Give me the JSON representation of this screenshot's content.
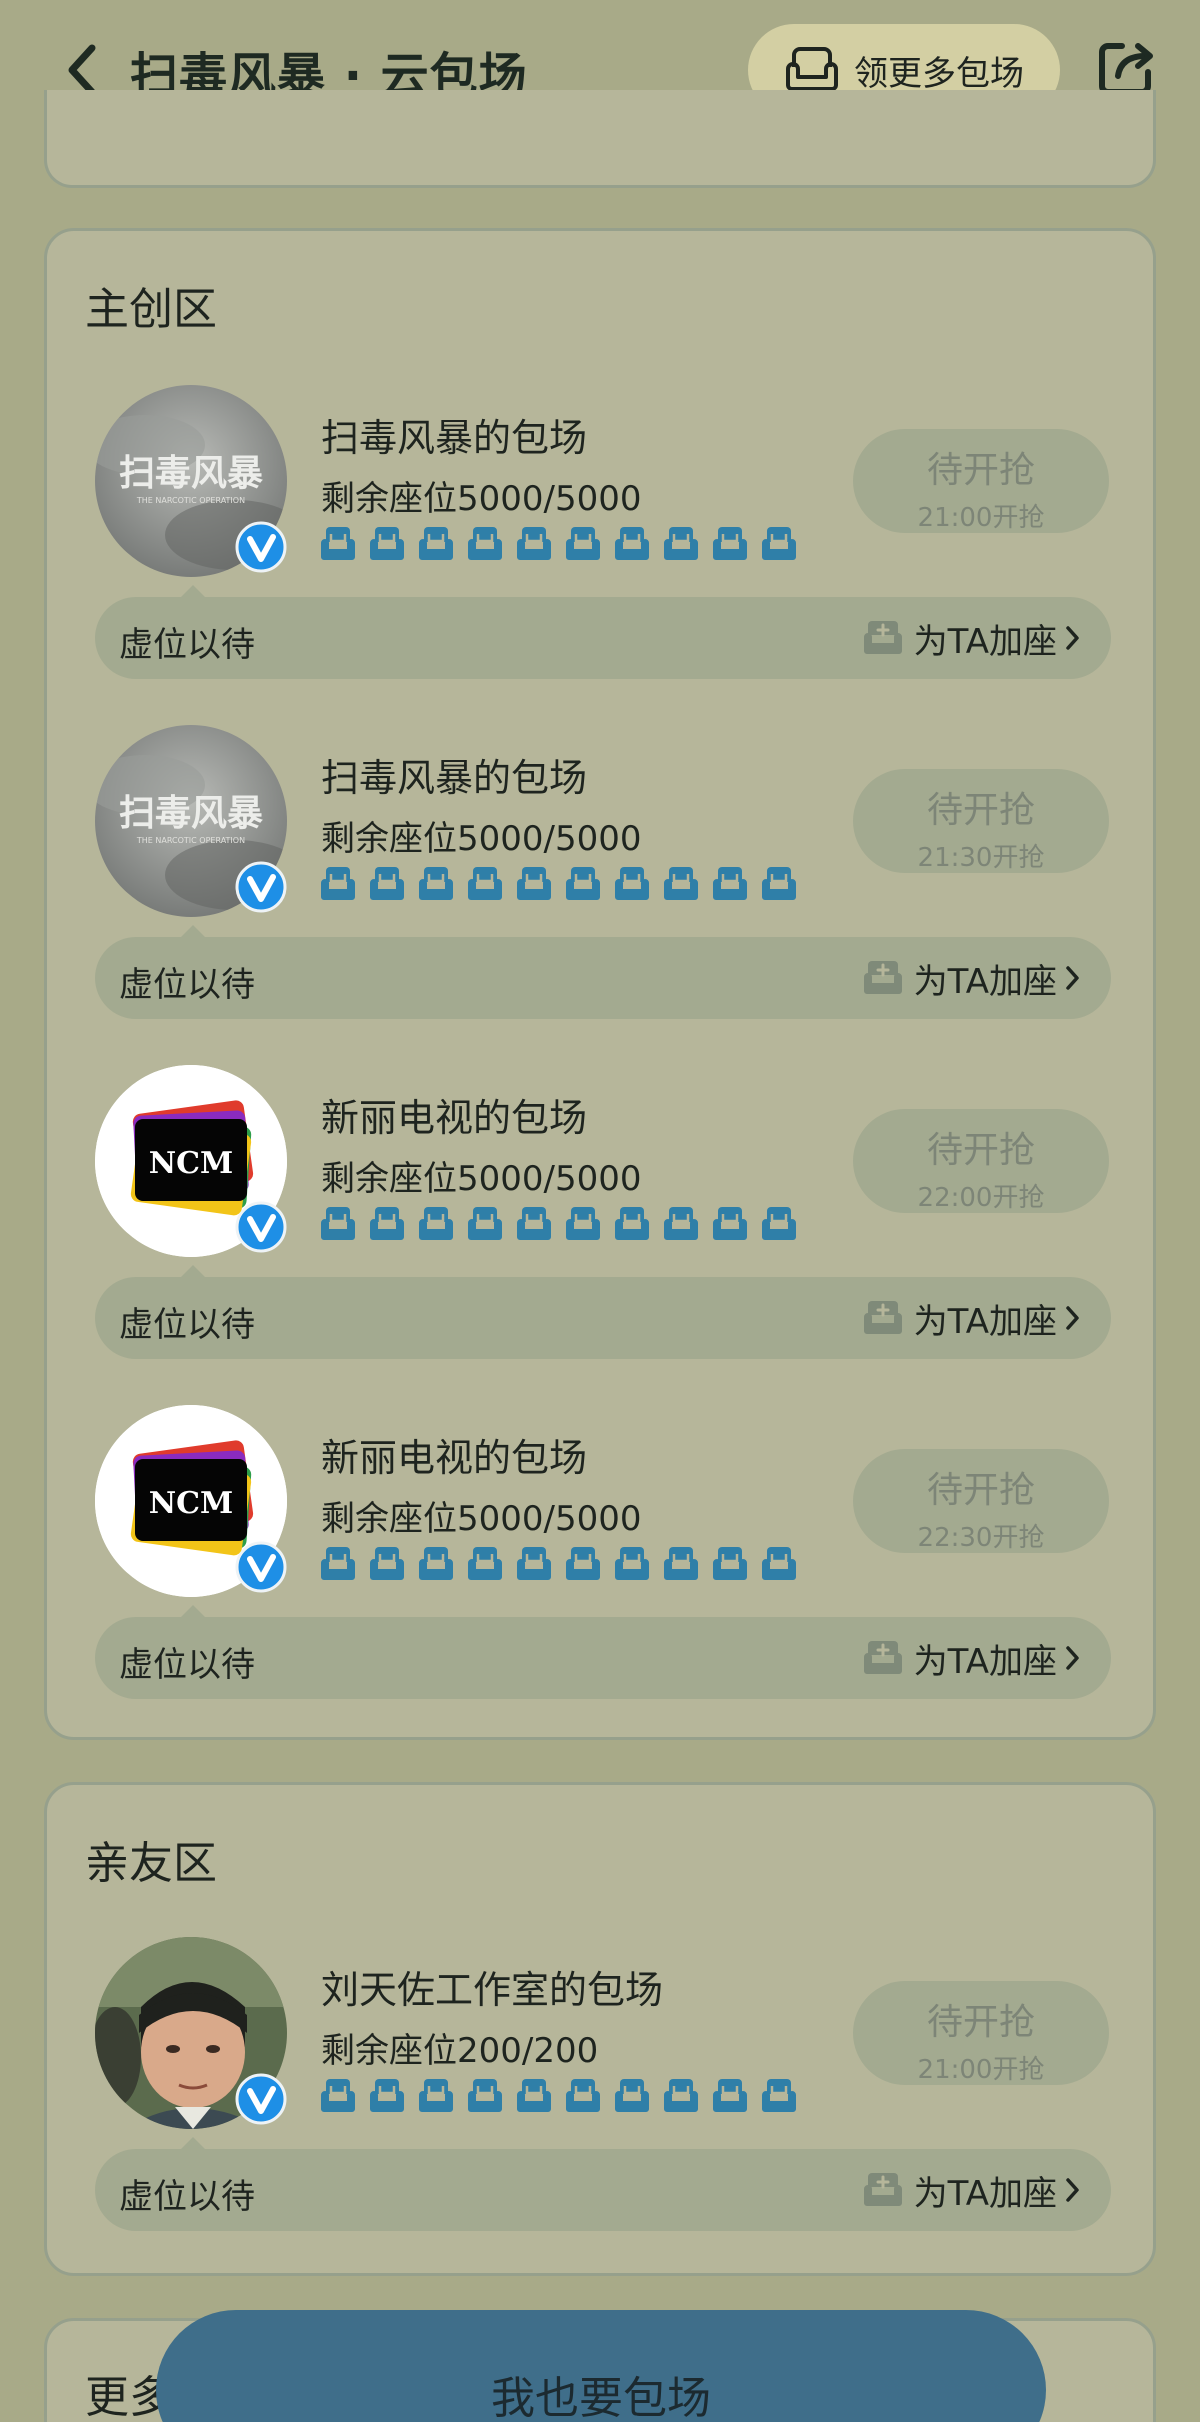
{
  "header": {
    "title": "扫毒风暴 · 云包场",
    "more_seats_label": "领更多包场"
  },
  "sections": [
    {
      "title": "主创区",
      "rooms": [
        {
          "name": "扫毒风暴的包场",
          "seats": "剩余座位5000/5000",
          "grab_label": "待开抢",
          "grab_time": "21:00开抢",
          "wait_label": "虚位以待",
          "add_label": "为TA加座",
          "avatar": "扫毒风暴",
          "avatar_sub": "THE NARCOTIC OPERATION"
        },
        {
          "name": "扫毒风暴的包场",
          "seats": "剩余座位5000/5000",
          "grab_label": "待开抢",
          "grab_time": "21:30开抢",
          "wait_label": "虚位以待",
          "add_label": "为TA加座",
          "avatar": "扫毒风暴",
          "avatar_sub": "THE NARCOTIC OPERATION"
        },
        {
          "name": "新丽电视的包场",
          "seats": "剩余座位5000/5000",
          "grab_label": "待开抢",
          "grab_time": "22:00开抢",
          "wait_label": "虚位以待",
          "add_label": "为TA加座",
          "avatar": "NCM"
        },
        {
          "name": "新丽电视的包场",
          "seats": "剩余座位5000/5000",
          "grab_label": "待开抢",
          "grab_time": "22:30开抢",
          "wait_label": "虚位以待",
          "add_label": "为TA加座",
          "avatar": "NCM"
        }
      ]
    },
    {
      "title": "亲友区",
      "rooms": [
        {
          "name": "刘天佐工作室的包场",
          "seats": "剩余座位200/200",
          "grab_label": "待开抢",
          "grab_time": "21:00开抢",
          "wait_label": "虚位以待",
          "add_label": "为TA加座"
        }
      ]
    }
  ],
  "bottom": {
    "section_title": "更多",
    "cta_label": "我也要包场"
  },
  "colors": {
    "background": "#a8aa88",
    "card": "#b6b69a",
    "seat_blue": "#2f7fa8",
    "badge_blue": "#1e8fe6",
    "cta": "#3f6e8a"
  }
}
